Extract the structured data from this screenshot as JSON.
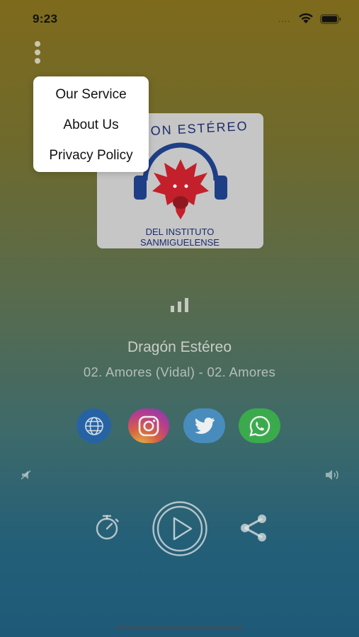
{
  "status_bar": {
    "time": "9:23",
    "signal_dots": "...."
  },
  "menu": {
    "items": [
      {
        "label": "Our Service"
      },
      {
        "label": "About Us"
      },
      {
        "label": "Privacy Policy"
      }
    ]
  },
  "artwork": {
    "arc_text": "ON ESTÉREO",
    "line1": "DEL INSTITUTO",
    "line2": "SANMIGUELENSE"
  },
  "player": {
    "station_name": "Dragón Estéreo",
    "track_title": "02. Amores (Vidal) - 02. Amores"
  },
  "social": [
    {
      "name": "web",
      "icon": "globe-icon",
      "color": "#2463ad"
    },
    {
      "name": "instagram",
      "icon": "instagram-icon",
      "color": "#c93a8c"
    },
    {
      "name": "twitter",
      "icon": "twitter-bird-icon",
      "color": "#4a90c8"
    },
    {
      "name": "whatsapp",
      "icon": "whatsapp-icon",
      "color": "#3bb24a"
    }
  ],
  "controls": {
    "timer_icon": "stopwatch-icon",
    "play_icon": "play-icon",
    "share_icon": "share-icon",
    "volume_low_icon": "volume-low-icon",
    "volume_high_icon": "volume-high-icon"
  }
}
